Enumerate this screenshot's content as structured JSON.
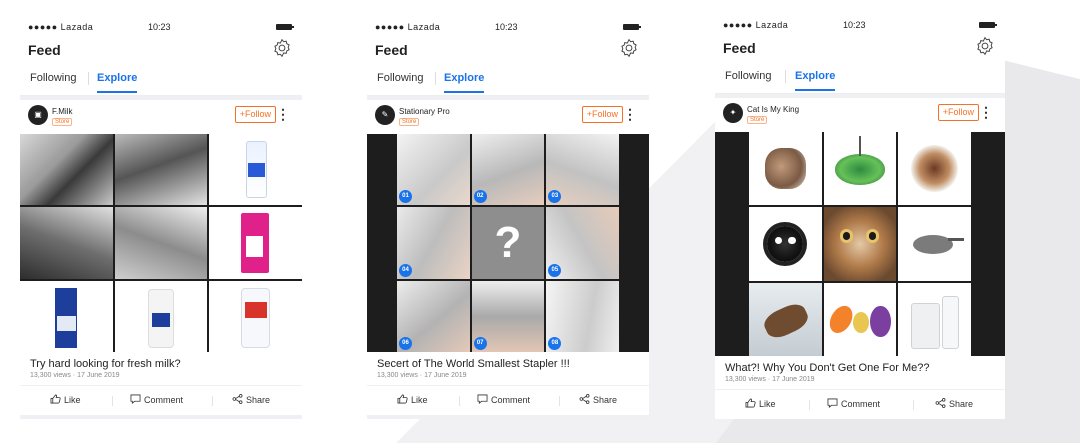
{
  "screens": [
    {
      "status": {
        "carrier": "●●●●● Lazada",
        "time": "10:23"
      },
      "header": {
        "title": "Feed",
        "settings_icon": "gear-icon"
      },
      "tabs": [
        {
          "label": "Following"
        },
        {
          "label": "Explore",
          "active": true
        }
      ],
      "post": {
        "shop_name": "F.Milk",
        "badge": "Store",
        "follow_label": "+Follow",
        "more_icon": "more-vertical-icon",
        "title": "Try hard looking for fresh milk?",
        "views": "13,300 views",
        "date": "17 June 2019"
      },
      "actions": {
        "like": "Like",
        "comment": "Comment",
        "share": "Share"
      }
    },
    {
      "status": {
        "carrier": "●●●●● Lazada",
        "time": "10:23"
      },
      "header": {
        "title": "Feed",
        "settings_icon": "gear-icon"
      },
      "tabs": [
        {
          "label": "Following"
        },
        {
          "label": "Explore",
          "active": true
        }
      ],
      "post": {
        "shop_name": "Stationary Pro",
        "badge": "Store",
        "follow_label": "+Follow",
        "more_icon": "more-vertical-icon",
        "title": "Secert of The World Smallest Stapler !!!",
        "views": "13,300 views",
        "date": "17 June 2019",
        "numbers": [
          "01",
          "02",
          "03",
          "04",
          "?",
          "05",
          "06",
          "07",
          "08"
        ]
      },
      "actions": {
        "like": "Like",
        "comment": "Comment",
        "share": "Share"
      }
    },
    {
      "status": {
        "carrier": "●●●●● Lazada",
        "time": "10:23"
      },
      "header": {
        "title": "Feed",
        "settings_icon": "gear-icon"
      },
      "tabs": [
        {
          "label": "Following"
        },
        {
          "label": "Explore",
          "active": true
        }
      ],
      "post": {
        "shop_name": "Cat Is My King",
        "badge": "Store",
        "follow_label": "+Follow",
        "more_icon": "more-vertical-icon",
        "title": "What?! Why You Don't Get One For Me??",
        "views": "13,300 views",
        "date": "17 June 2019"
      },
      "actions": {
        "like": "Like",
        "comment": "Comment",
        "share": "Share"
      }
    }
  ],
  "colors": {
    "accent": "#1a73e8",
    "follow": "#f57224"
  }
}
